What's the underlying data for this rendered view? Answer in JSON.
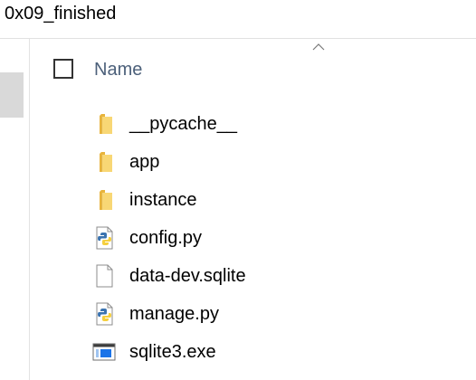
{
  "window": {
    "title": "0x09_finished"
  },
  "header": {
    "column_name": "Name",
    "sort_direction": "ascending"
  },
  "files": [
    {
      "name": "__pycache__",
      "type": "folder",
      "icon": "folder-icon"
    },
    {
      "name": "app",
      "type": "folder",
      "icon": "folder-icon"
    },
    {
      "name": "instance",
      "type": "folder",
      "icon": "folder-icon"
    },
    {
      "name": "config.py",
      "type": "python-file",
      "icon": "python-file-icon"
    },
    {
      "name": "data-dev.sqlite",
      "type": "file",
      "icon": "blank-file-icon"
    },
    {
      "name": "manage.py",
      "type": "python-file",
      "icon": "python-file-icon"
    },
    {
      "name": "sqlite3.exe",
      "type": "executable",
      "icon": "exe-file-icon"
    }
  ],
  "colors": {
    "folder": "#f8d775",
    "folder_dark": "#e8b43c",
    "header_text": "#4c607a",
    "python_blue": "#3a73b0",
    "python_yellow": "#f5cf3e",
    "exe_blue": "#1a73e8"
  }
}
